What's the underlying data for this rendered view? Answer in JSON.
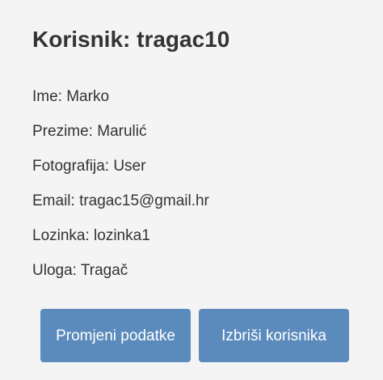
{
  "page": {
    "title": "Korisnik: tragac10"
  },
  "user": {
    "fields": [
      "Ime: Marko",
      "Prezime: Marulić",
      "Fotografija: User",
      "Email: tragac15@gmail.hr",
      "Lozinka: lozinka1",
      "Uloga: Tragač"
    ]
  },
  "actions": {
    "edit_label": "Promjeni podatke",
    "delete_label": "Izbriši korisnika"
  },
  "colors": {
    "background": "#f4f4f4",
    "button": "#5b8bbd",
    "text": "#333333"
  }
}
